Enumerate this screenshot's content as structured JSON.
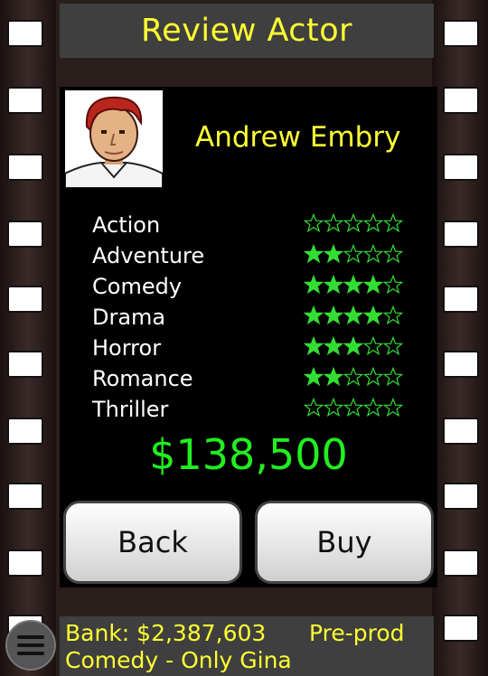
{
  "header": {
    "title": "Review Actor"
  },
  "actor": {
    "name": "Andrew Embry",
    "avatar_icon": "pixel-portrait-red-hair",
    "price": "$138,500",
    "genres": [
      {
        "label": "Action",
        "stars": 0
      },
      {
        "label": "Adventure",
        "stars": 2
      },
      {
        "label": "Comedy",
        "stars": 4
      },
      {
        "label": "Drama",
        "stars": 4
      },
      {
        "label": "Horror",
        "stars": 3
      },
      {
        "label": "Romance",
        "stars": 2
      },
      {
        "label": "Thriller",
        "stars": 0
      }
    ],
    "max_stars": 5
  },
  "buttons": {
    "back_label": "Back",
    "buy_label": "Buy"
  },
  "status": {
    "bank": "Bank: $2,387,603",
    "phase": "Pre-prod",
    "film": "Comedy - Only Gina"
  },
  "colors": {
    "accent": "#ffff33",
    "price": "#22ee22",
    "star": "#33dd33"
  }
}
